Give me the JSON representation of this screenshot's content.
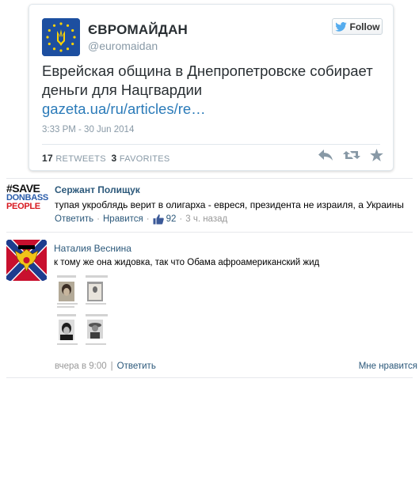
{
  "tweet": {
    "display_name": "ЄВРОМАЙДАН",
    "handle": "@euromaidan",
    "follow_label": "Follow",
    "text": "Еврейская община в Днепропетровске собирает деньги для Нацгвардии",
    "link": "gazeta.ua/ru/articles/re…",
    "timestamp": "3:33 PM - 30 Jun 2014",
    "retweets_count": "17",
    "retweets_label": "RETWEETS",
    "favorites_count": "3",
    "favorites_label": "FAVORITES",
    "icons": [
      "reply-icon",
      "retweet-icon",
      "favorite-icon"
    ],
    "colors": {
      "link": "#2b7bb9",
      "avatar_bg": "#1d4fa0",
      "twitter_blue": "#55acee"
    }
  },
  "comments": [
    {
      "avatar": {
        "line1": "#SAVE",
        "line2": "DONBASS",
        "line3": "PEOPLE"
      },
      "author": "Сержант Полищук",
      "text": "тупая укроблядь верит в олигарха - евреся, президента не израиля, а Украины",
      "reply": "Ответить",
      "like": "Нравится",
      "likes_count": "92",
      "time": "3 ч. назад"
    },
    {
      "author": "Наталия Веснина",
      "text": "к тому же она жидовка, так что Обама афроамериканский жид",
      "time": "вчера в 9:00",
      "reply": "Ответить",
      "like": "Мне нравится"
    }
  ],
  "colors": {
    "author": "#2b587a",
    "meta": "#999999",
    "divider": "#e7e8ec"
  }
}
